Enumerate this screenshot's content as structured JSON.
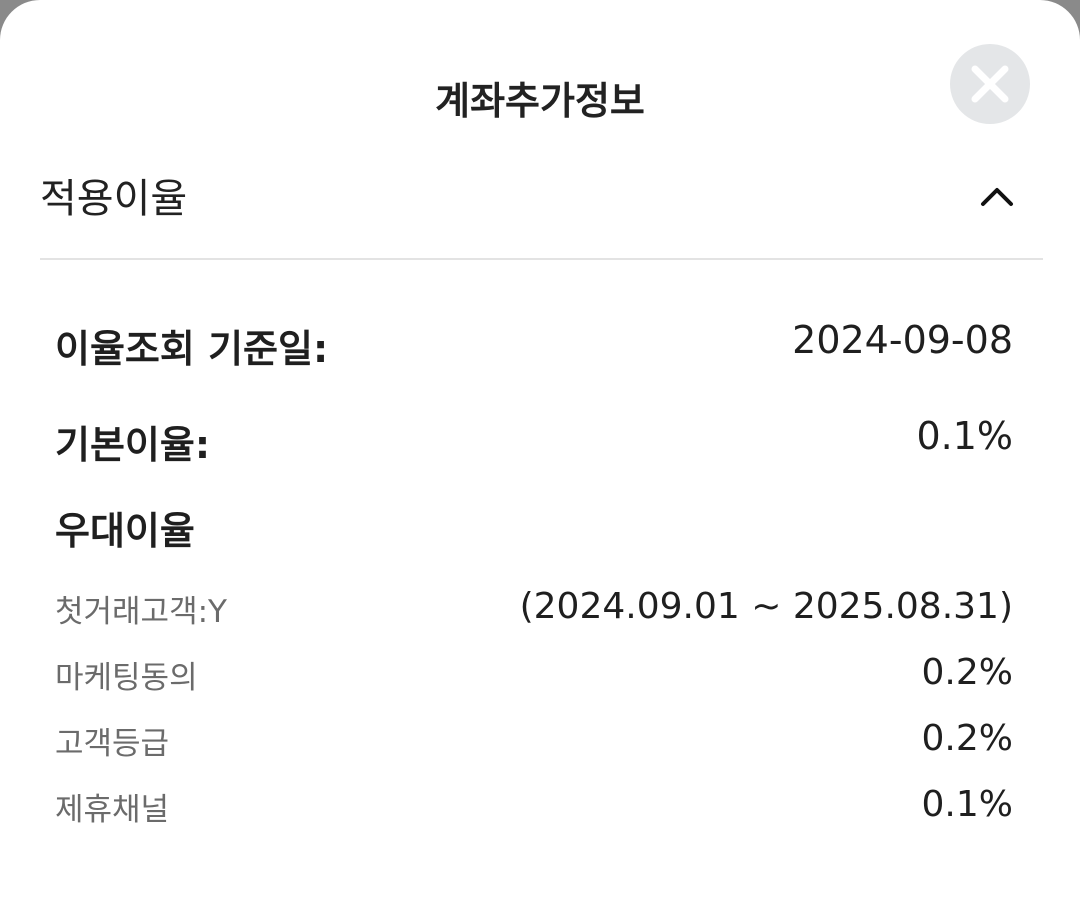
{
  "sheet": {
    "title": "계좌추가정보",
    "close_icon": "close-x-icon"
  },
  "section": {
    "title": "적용이율",
    "toggle_icon": "chevron-up-icon",
    "expanded": true
  },
  "rates": {
    "base_date_label": "이율조회 기준일:",
    "base_date_value": "2024-09-08",
    "base_rate_label": "기본이율:",
    "base_rate_value": "0.1%",
    "preferential_heading": "우대이율",
    "items": [
      {
        "label": "첫거래고객:Y",
        "value": "(2024.09.01 ~ 2025.08.31)"
      },
      {
        "label": "마케팅동의",
        "value": "0.2%"
      },
      {
        "label": "고객등급",
        "value": "0.2%"
      },
      {
        "label": "제휴채널",
        "value": "0.1%"
      }
    ]
  },
  "colors": {
    "background": "#ffffff",
    "text_primary": "#1f1f1f",
    "text_secondary": "#6b6b6b",
    "divider": "#e3e3e3",
    "close_button_bg": "#e4e6e8"
  }
}
